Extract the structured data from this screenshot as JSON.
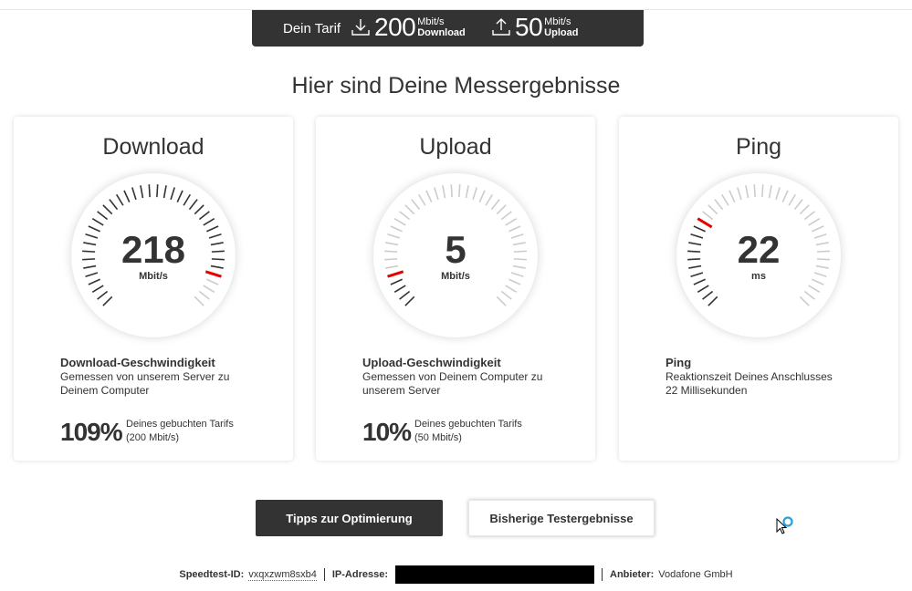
{
  "tarif": {
    "label": "Dein Tarif",
    "download": {
      "value": "200",
      "unit": "Mbit/s",
      "label": "Download",
      "icon": "download-icon"
    },
    "upload": {
      "value": "50",
      "unit": "Mbit/s",
      "label": "Upload",
      "icon": "upload-icon"
    }
  },
  "heading": "Hier sind Deine Messergebnisse",
  "cards": [
    {
      "title": "Download",
      "value": "218",
      "unit": "Mbit/s",
      "desc_title": "Download-Geschwindigkeit",
      "desc_text": "Gemessen von unserem Server zu Deinem Computer",
      "percent": "109%",
      "percent_text_1": "Deines gebuchten Tarifs",
      "percent_text_2": "(200 Mbit/s)",
      "gauge_fraction": 0.91
    },
    {
      "title": "Upload",
      "value": "5",
      "unit": "Mbit/s",
      "desc_title": "Upload-Geschwindigkeit",
      "desc_text": "Gemessen von Deinem Computer zu unserem Server",
      "percent": "10%",
      "percent_text_1": "Deines gebuchten Tarifs",
      "percent_text_2": "(50 Mbit/s)",
      "gauge_fraction": 0.1
    },
    {
      "title": "Ping",
      "value": "22",
      "unit": "ms",
      "desc_title": "Ping",
      "desc_text": "Reaktionszeit Deines Anschlusses 22 Millisekunden",
      "gauge_fraction": 0.29
    }
  ],
  "buttons": {
    "tips": "Tipps zur Optimierung",
    "history": "Bisherige Testergebnisse"
  },
  "footer": {
    "speedtest_id_label": "Speedtest-ID:",
    "speedtest_id": "vxqxzwm8sxb4",
    "ip_label": "IP-Adresse:",
    "provider_label": "Anbieter:",
    "provider": "Vodafone GmbH"
  },
  "colors": {
    "dark": "#333333",
    "accent": "#e60000",
    "tick_active": "#333333",
    "tick_inactive": "#cccccc"
  }
}
